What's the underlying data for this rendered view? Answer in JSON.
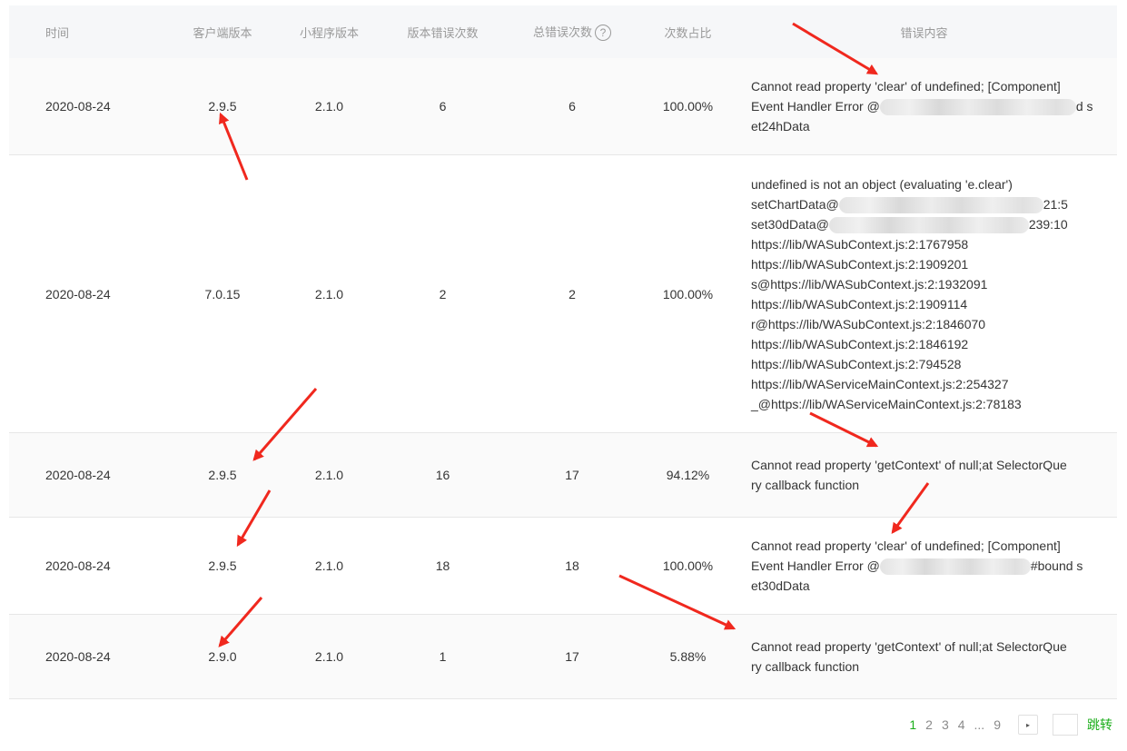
{
  "columns": {
    "time": "时间",
    "client_version": "客户端版本",
    "miniprogram_version": "小程序版本",
    "version_error_count": "版本错误次数",
    "total_error_count": "总错误次数",
    "ratio": "次数占比",
    "error_content": "错误内容"
  },
  "help_icon_glyph": "?",
  "rows": [
    {
      "time": "2020-08-24",
      "client": "2.9.5",
      "mp": "2.1.0",
      "ver_count": "6",
      "total": "6",
      "ratio": "100.00%",
      "err_lines": [
        "Cannot read property 'clear' of undefined; [Component]",
        "Event Handler Error @",
        "d s",
        "et24hData"
      ]
    },
    {
      "time": "2020-08-24",
      "client": "7.0.15",
      "mp": "2.1.0",
      "ver_count": "2",
      "total": "2",
      "ratio": "100.00%",
      "err_lines": [
        "undefined is not an object (evaluating 'e.clear')",
        "setChartData@",
        "21:5",
        "set30dData@",
        "239:10",
        "https://lib/WASubContext.js:2:1767958",
        "https://lib/WASubContext.js:2:1909201",
        "s@https://lib/WASubContext.js:2:1932091",
        "https://lib/WASubContext.js:2:1909114",
        "r@https://lib/WASubContext.js:2:1846070",
        "https://lib/WASubContext.js:2:1846192",
        "https://lib/WASubContext.js:2:794528",
        "https://lib/WAServiceMainContext.js:2:254327",
        "_@https://lib/WAServiceMainContext.js:2:78183"
      ]
    },
    {
      "time": "2020-08-24",
      "client": "2.9.5",
      "mp": "2.1.0",
      "ver_count": "16",
      "total": "17",
      "ratio": "94.12%",
      "err_lines": [
        "Cannot read property 'getContext' of null;at SelectorQue",
        "ry callback function"
      ]
    },
    {
      "time": "2020-08-24",
      "client": "2.9.5",
      "mp": "2.1.0",
      "ver_count": "18",
      "total": "18",
      "ratio": "100.00%",
      "err_lines": [
        "Cannot read property 'clear' of undefined; [Component]",
        "Event Handler Error @",
        "#bound s",
        "et30dData"
      ]
    },
    {
      "time": "2020-08-24",
      "client": "2.9.0",
      "mp": "2.1.0",
      "ver_count": "1",
      "total": "17",
      "ratio": "5.88%",
      "err_lines": [
        "Cannot read property 'getContext' of null;at SelectorQue",
        "ry callback function"
      ]
    }
  ],
  "pagination": {
    "pages": [
      "1",
      "2",
      "3",
      "4",
      "...",
      "9"
    ],
    "active_page": "1",
    "next_glyph": "▸",
    "jump_label": "跳转"
  },
  "colors": {
    "accent_green": "#1aad19",
    "annotation_arrow_red": "#f0281e",
    "header_bg": "#f6f7f9"
  }
}
